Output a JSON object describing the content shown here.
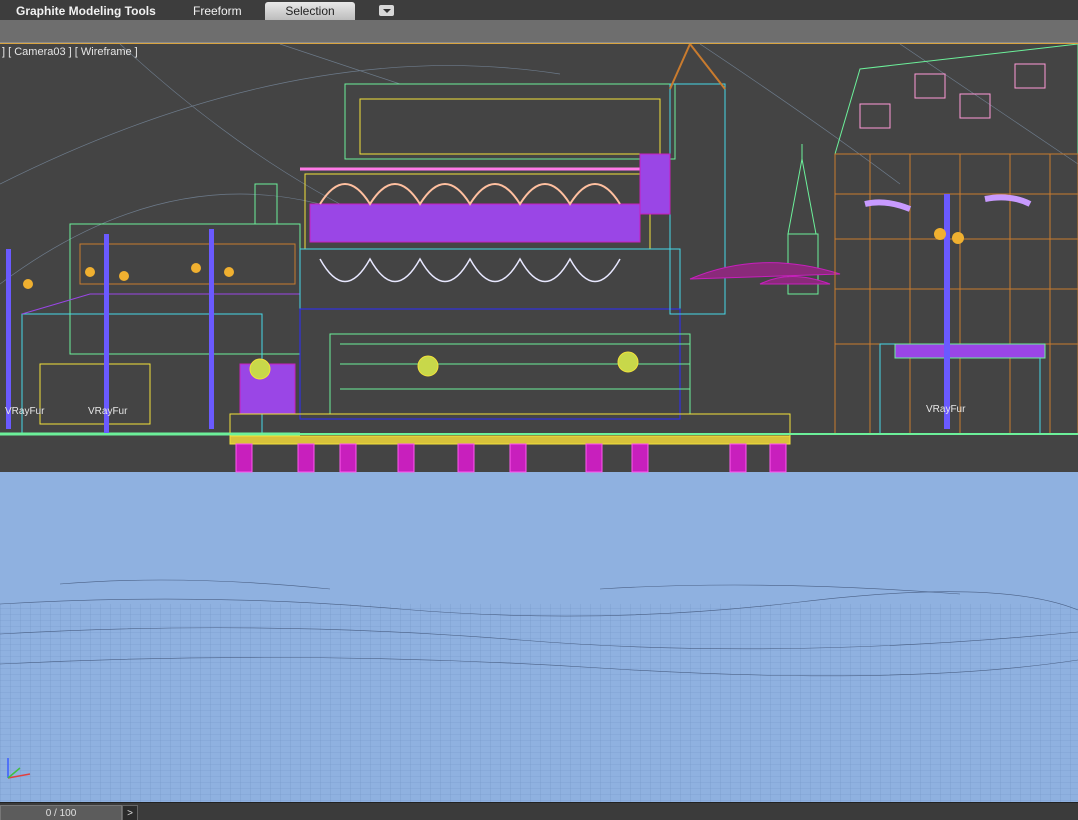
{
  "ribbon": {
    "tabs": [
      {
        "label": "Graphite Modeling Tools"
      },
      {
        "label": "Freeform"
      },
      {
        "label": "Selection",
        "active": true
      }
    ]
  },
  "viewport": {
    "label_open": "] [ ",
    "camera": "Camera03",
    "label_mid": " ] [ ",
    "shading": "Wireframe",
    "label_close": " ]",
    "vray_labels": [
      "VRayFur",
      "VRayFur",
      "VRayFur"
    ]
  },
  "colors": {
    "ocean": "#8fb1e0",
    "wire_green": "#6cf09a",
    "wire_yellow": "#f3e23a",
    "wire_magenta": "#c81fbd",
    "wire_cyan": "#46d8e8",
    "wire_orange": "#c97b2e",
    "wire_purple": "#9a46e6"
  },
  "timeline": {
    "frame": "0 / 100",
    "next": ">"
  }
}
